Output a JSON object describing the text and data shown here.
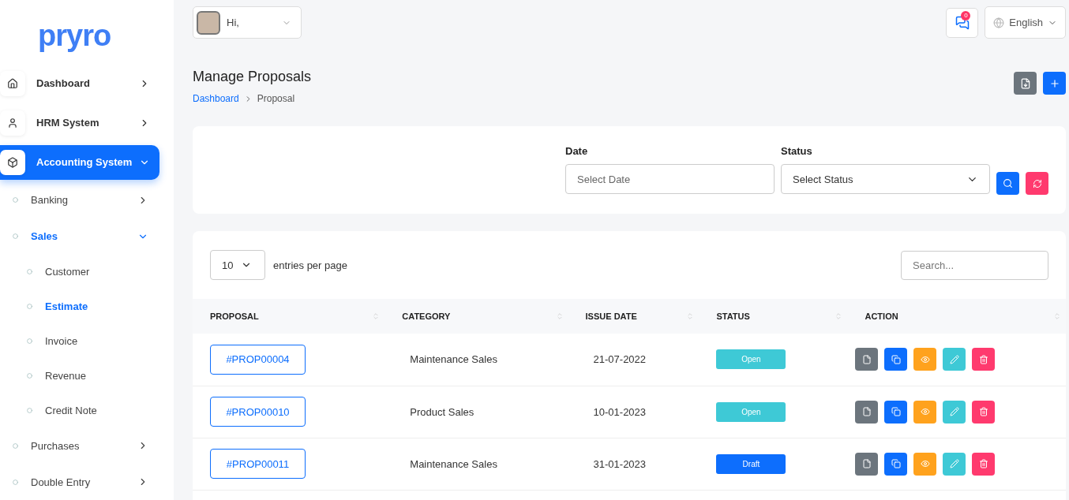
{
  "logo": "pryro",
  "user": {
    "greeting": "Hi,"
  },
  "notifications": {
    "count": "0"
  },
  "language": "English",
  "sidebar": {
    "items": [
      {
        "label": "Dashboard",
        "selected": false,
        "expanded": false
      },
      {
        "label": "HRM System",
        "selected": false,
        "expanded": false
      },
      {
        "label": "Accounting System",
        "selected": true,
        "expanded": true,
        "children": [
          {
            "label": "Banking",
            "selected": false,
            "expanded": false
          },
          {
            "label": "Sales",
            "selected": true,
            "expanded": true,
            "children": [
              {
                "label": "Customer",
                "selected": false
              },
              {
                "label": "Estimate",
                "selected": true
              },
              {
                "label": "Invoice",
                "selected": false
              },
              {
                "label": "Revenue",
                "selected": false
              },
              {
                "label": "Credit Note",
                "selected": false
              }
            ]
          },
          {
            "label": "Purchases",
            "selected": false,
            "expanded": false
          },
          {
            "label": "Double Entry",
            "selected": false,
            "expanded": false
          }
        ]
      }
    ]
  },
  "page": {
    "title": "Manage Proposals",
    "breadcrumb": [
      "Dashboard",
      "Proposal"
    ]
  },
  "filters": {
    "date": {
      "label": "Date",
      "placeholder": "Select Date"
    },
    "status": {
      "label": "Status",
      "value": "Select Status"
    }
  },
  "table": {
    "entries": "10",
    "entries_label": "entries per page",
    "search_placeholder": "Search...",
    "columns": [
      "PROPOSAL",
      "CATEGORY",
      "ISSUE DATE",
      "STATUS",
      "ACTION"
    ],
    "rows": [
      {
        "proposal": "#PROP00004",
        "category": "Maintenance Sales",
        "issue_date": "21-07-2022",
        "status": {
          "label": "Open",
          "kind": "open"
        }
      },
      {
        "proposal": "#PROP00010",
        "category": "Product Sales",
        "issue_date": "10-01-2023",
        "status": {
          "label": "Open",
          "kind": "open"
        }
      },
      {
        "proposal": "#PROP00011",
        "category": "Maintenance Sales",
        "issue_date": "31-01-2023",
        "status": {
          "label": "Draft",
          "kind": "draft"
        }
      }
    ]
  }
}
